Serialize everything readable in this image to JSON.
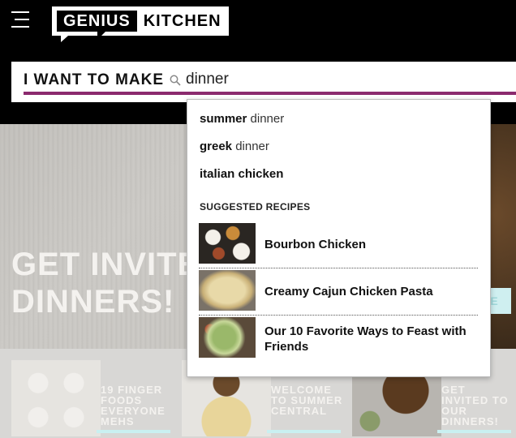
{
  "header": {
    "logo_left": "GENIUS",
    "logo_right": "KITCHEN"
  },
  "search": {
    "label": "I WANT TO MAKE",
    "value": "dinner"
  },
  "autocomplete": {
    "suggestions": [
      {
        "bold": "summer",
        "rest": " dinner"
      },
      {
        "bold": "greek",
        "rest": " dinner"
      },
      {
        "bold": "italian chicken",
        "rest": ""
      }
    ],
    "recipes_header": "SUGGESTED RECIPES",
    "recipes": [
      {
        "title": "Bourbon Chicken"
      },
      {
        "title": "Creamy Cajun Chicken Pasta"
      },
      {
        "title": "Our 10 Favorite Ways to Feast with Friends"
      }
    ]
  },
  "hero": {
    "line1": "GET INVITED TO OUR",
    "line2": "DINNERS!",
    "cta": "E"
  },
  "cards": [
    {
      "text": "19 FINGER FOODS EVERYONE MEHS"
    },
    {
      "text": "WELCOME TO SUMMER CENTRAL"
    },
    {
      "text": "GET INVITED TO OUR DINNERS!"
    }
  ],
  "colors": {
    "accent": "#8b2a6e",
    "cta": "#cfeff0"
  }
}
